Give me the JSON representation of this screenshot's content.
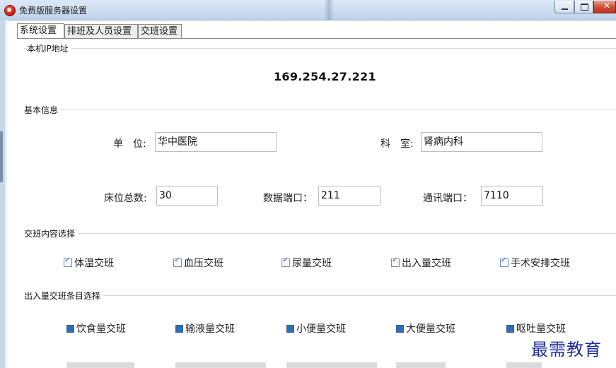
{
  "window": {
    "title": "免费版服务器设置"
  },
  "tabs": [
    "系统设置",
    "排班及人员设置",
    "交班设置"
  ],
  "groups": {
    "ip": {
      "title": "本机IP地址",
      "address": "169.254.27.221"
    },
    "basic": {
      "title": "基本信息",
      "unit_label": "单　位:",
      "unit_value": "华中医院",
      "dept_label": "科　室:",
      "dept_value": "肾病内科",
      "beds_label": "床位总数:",
      "beds_value": "30",
      "data_port_label": "数据端口：",
      "data_port_value": "211",
      "comm_port_label": "通讯端口：",
      "comm_port_value": "7110"
    },
    "shift_content": {
      "title": "交班内容选择",
      "items": [
        "体温交班",
        "血压交班",
        "尿量交班",
        "出入量交班",
        "手术安排交班"
      ]
    },
    "io_items": {
      "title": "出入量交班条目选择",
      "items": [
        "饮食量交班",
        "输液量交班",
        "小便量交班",
        "大便量交班",
        "呕吐量交班"
      ]
    }
  },
  "watermark": "最需教育",
  "colors": {
    "titlebar": "#cfdff1",
    "close": "#cf4a34",
    "watermark": "#1e2fa3"
  }
}
